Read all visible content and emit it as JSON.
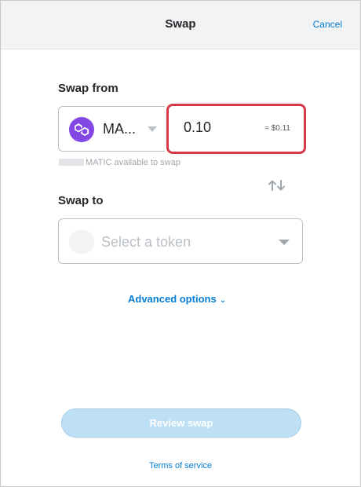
{
  "header": {
    "title": "Swap",
    "cancel_label": "Cancel"
  },
  "swap_from": {
    "label": "Swap from",
    "token": {
      "symbol": "MA...",
      "icon": "polygon-matic-logo-icon",
      "brand_color": "#8247e5"
    },
    "amount": "0.10",
    "fiat": "≈ $0.11",
    "balance_text": "MATIC available to swap"
  },
  "swap_to": {
    "label": "Swap to",
    "placeholder": "Select a token"
  },
  "advanced_options_label": "Advanced options",
  "review_button_label": "Review swap",
  "terms_label": "Terms of service",
  "colors": {
    "link": "#037dd6",
    "highlight_border": "#d73a49",
    "disabled_button": "#bee0f5"
  }
}
